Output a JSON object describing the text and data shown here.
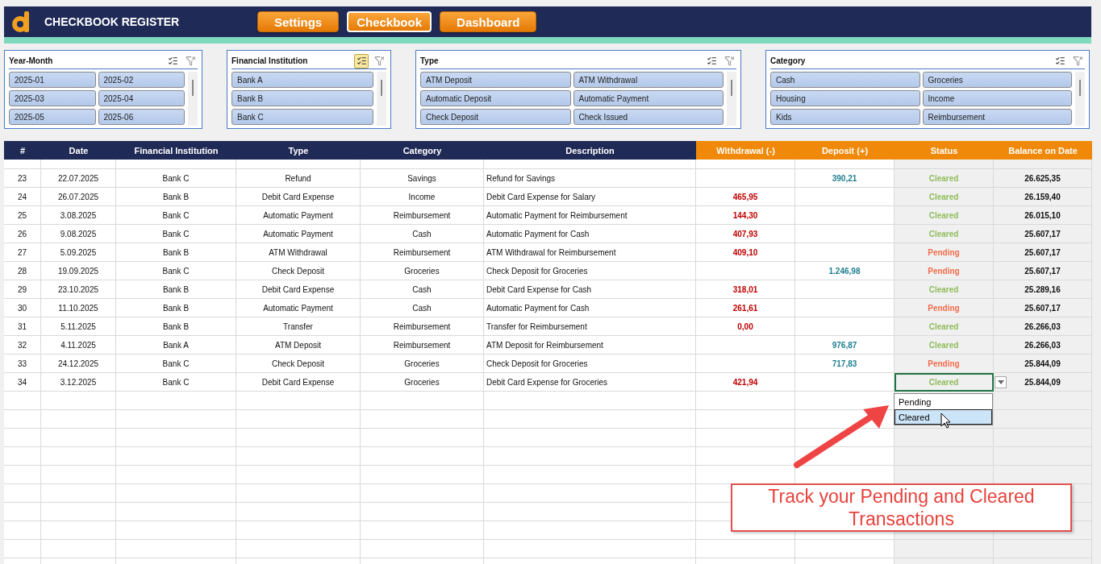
{
  "header": {
    "title": "CHECKBOOK REGISTER",
    "nav": [
      {
        "label": "Settings",
        "selected": false
      },
      {
        "label": "Checkbook",
        "selected": true
      },
      {
        "label": "Dashboard",
        "selected": false
      }
    ]
  },
  "slicers": [
    {
      "title": "Year-Month",
      "multi_select": false,
      "items": [
        {
          "label": "2025-01",
          "selected": true
        },
        {
          "label": "2025-02",
          "selected": true
        },
        {
          "label": "2025-03",
          "selected": true
        },
        {
          "label": "2025-04",
          "selected": true
        },
        {
          "label": "2025-05",
          "selected": true
        },
        {
          "label": "2025-06",
          "selected": true
        }
      ]
    },
    {
      "title": "Financial Institution",
      "multi_select": true,
      "items": [
        {
          "label": "Bank A",
          "selected": true
        },
        {
          "label": "Bank B",
          "selected": true
        },
        {
          "label": "Bank C",
          "selected": true
        }
      ]
    },
    {
      "title": "Type",
      "multi_select": false,
      "items": [
        {
          "label": "ATM Deposit",
          "selected": true
        },
        {
          "label": "ATM Withdrawal",
          "selected": true
        },
        {
          "label": "Automatic Deposit",
          "selected": true
        },
        {
          "label": "Automatic Payment",
          "selected": true
        },
        {
          "label": "Check Deposit",
          "selected": true
        },
        {
          "label": "Check Issued",
          "selected": true
        }
      ]
    },
    {
      "title": "Category",
      "multi_select": false,
      "items": [
        {
          "label": "Cash",
          "selected": true
        },
        {
          "label": "Groceries",
          "selected": true
        },
        {
          "label": "Housing",
          "selected": true
        },
        {
          "label": "Income",
          "selected": true
        },
        {
          "label": "Kids",
          "selected": true
        },
        {
          "label": "Reimbursement",
          "selected": true
        }
      ]
    }
  ],
  "table": {
    "columns": [
      "#",
      "Date",
      "Financial Institution",
      "Type",
      "Category",
      "Description",
      "Withdrawal (-)",
      "Deposit (+)",
      "Status",
      "Balance on Date"
    ],
    "rows": [
      {
        "no": "23",
        "date": "22.07.2025",
        "institution": "Bank C",
        "type": "Refund",
        "category": "Savings",
        "description": "Refund for Savings",
        "withdrawal": "",
        "deposit": "390,21",
        "status": "Cleared",
        "pending": false,
        "balance": "26.625,35",
        "active": false
      },
      {
        "no": "24",
        "date": "26.07.2025",
        "institution": "Bank B",
        "type": "Debit Card Expense",
        "category": "Income",
        "description": "Debit Card Expense for Salary",
        "withdrawal": "465,95",
        "deposit": "",
        "status": "Cleared",
        "pending": false,
        "balance": "26.159,40",
        "active": false
      },
      {
        "no": "25",
        "date": "3.08.2025",
        "institution": "Bank C",
        "type": "Automatic Payment",
        "category": "Reimbursement",
        "description": "Automatic Payment for Reimbursement",
        "withdrawal": "144,30",
        "deposit": "",
        "status": "Cleared",
        "pending": false,
        "balance": "26.015,10",
        "active": false
      },
      {
        "no": "26",
        "date": "9.08.2025",
        "institution": "Bank C",
        "type": "Automatic Payment",
        "category": "Cash",
        "description": "Automatic Payment for Cash",
        "withdrawal": "407,93",
        "deposit": "",
        "status": "Cleared",
        "pending": false,
        "balance": "25.607,17",
        "active": false
      },
      {
        "no": "27",
        "date": "5.09.2025",
        "institution": "Bank B",
        "type": "ATM Withdrawal",
        "category": "Reimbursement",
        "description": "ATM Withdrawal for Reimbursement",
        "withdrawal": "409,10",
        "deposit": "",
        "status": "Pending",
        "pending": true,
        "balance": "25.607,17",
        "active": false
      },
      {
        "no": "28",
        "date": "19.09.2025",
        "institution": "Bank C",
        "type": "Check Deposit",
        "category": "Groceries",
        "description": "Check Deposit for Groceries",
        "withdrawal": "",
        "deposit": "1.246,98",
        "status": "Pending",
        "pending": true,
        "balance": "25.607,17",
        "active": false
      },
      {
        "no": "29",
        "date": "23.10.2025",
        "institution": "Bank B",
        "type": "Debit Card Expense",
        "category": "Cash",
        "description": "Debit Card Expense for Cash",
        "withdrawal": "318,01",
        "deposit": "",
        "status": "Cleared",
        "pending": false,
        "balance": "25.289,16",
        "active": false
      },
      {
        "no": "30",
        "date": "11.10.2025",
        "institution": "Bank B",
        "type": "Automatic Payment",
        "category": "Cash",
        "description": "Automatic Payment for Cash",
        "withdrawal": "261,61",
        "deposit": "",
        "status": "Pending",
        "pending": true,
        "balance": "25.607,17",
        "active": false
      },
      {
        "no": "31",
        "date": "5.11.2025",
        "institution": "Bank B",
        "type": "Transfer",
        "category": "Reimbursement",
        "description": "Transfer for Reimbursement",
        "withdrawal": "0,00",
        "deposit": "",
        "status": "Cleared",
        "pending": false,
        "balance": "26.266,03",
        "active": false
      },
      {
        "no": "32",
        "date": "4.11.2025",
        "institution": "Bank A",
        "type": "ATM Deposit",
        "category": "Reimbursement",
        "description": "ATM Deposit for Reimbursement",
        "withdrawal": "",
        "deposit": "976,87",
        "status": "Cleared",
        "pending": false,
        "balance": "26.266,03",
        "active": false
      },
      {
        "no": "33",
        "date": "24.12.2025",
        "institution": "Bank C",
        "type": "Check Deposit",
        "category": "Groceries",
        "description": "Check Deposit for Groceries",
        "withdrawal": "",
        "deposit": "717,83",
        "status": "Pending",
        "pending": true,
        "balance": "25.844,09",
        "active": false
      },
      {
        "no": "34",
        "date": "3.12.2025",
        "institution": "Bank C",
        "type": "Debit Card Expense",
        "category": "Groceries",
        "description": "Debit Card Expense for Groceries",
        "withdrawal": "421,94",
        "deposit": "",
        "status": "Cleared",
        "pending": false,
        "balance": "25.844,09",
        "active": true
      }
    ]
  },
  "dropdown": {
    "options": [
      {
        "label": "Pending",
        "selected": false
      },
      {
        "label": "Cleared",
        "selected": true
      }
    ]
  },
  "callout": {
    "text": "Track your Pending and Cleared Transactions"
  }
}
